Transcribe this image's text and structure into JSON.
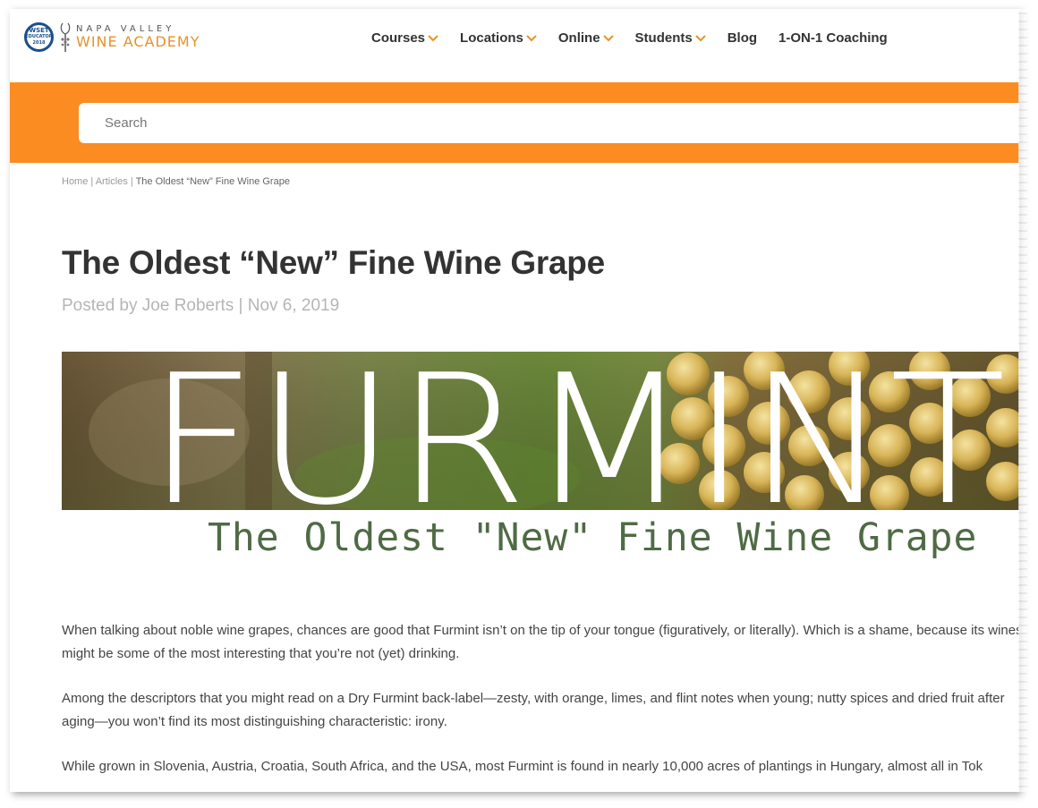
{
  "logo": {
    "badge_text": "WSET",
    "badge_sub": "EDUCATOR",
    "badge_year": "2018",
    "line1": "NAPA VALLEY",
    "line2": "WINE ACADEMY"
  },
  "nav": {
    "items": [
      {
        "label": "Courses",
        "has_dropdown": true
      },
      {
        "label": "Locations",
        "has_dropdown": true
      },
      {
        "label": "Online",
        "has_dropdown": true
      },
      {
        "label": "Students",
        "has_dropdown": true
      },
      {
        "label": "Blog",
        "has_dropdown": false
      },
      {
        "label": "1-ON-1 Coaching",
        "has_dropdown": false
      }
    ]
  },
  "search": {
    "placeholder": "Search"
  },
  "breadcrumb": {
    "home": "Home",
    "articles": "Articles",
    "current": "The Oldest “New” Fine Wine Grape",
    "separator": " | "
  },
  "article": {
    "title": "The Oldest “New” Fine Wine Grape",
    "posted_by_prefix": "Posted by ",
    "author": "Joe Roberts",
    "meta_separator": " | ",
    "date": "Nov 6, 2019",
    "hero": {
      "word": "FURMINT",
      "subtitle": "The Oldest \"New\" Fine Wine Grape"
    },
    "paragraphs": [
      "When talking about noble wine grapes, chances are good that Furmint isn’t on the tip of your tongue (figuratively, or literally). Which is a shame, because its wines might be some of the most interesting that you’re not (yet) drinking.",
      "Among the descriptors that you might read on a Dry Furmint back-label—zesty, with orange, limes, and flint notes when young; nutty spices and dried fruit after aging—you won’t find its most distinguishing characteristic: irony.",
      "While grown in Slovenia, Austria, Croatia, South Africa, and the USA, most Furmint is found in nearly 10,000 acres of plantings in Hungary, almost all in Tok"
    ]
  },
  "colors": {
    "accent_orange": "#fb8c22",
    "logo_orange": "#e7922b",
    "hero_green": "#4f6b45",
    "text_dark": "#333333"
  }
}
